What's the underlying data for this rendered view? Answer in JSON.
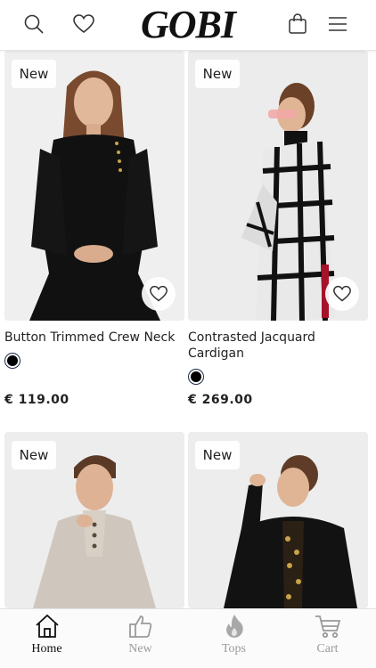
{
  "header": {
    "logo": "GOBI",
    "icons": [
      "search-icon",
      "heart-icon",
      "bag-icon",
      "menu-icon"
    ]
  },
  "products": [
    {
      "badge": "New",
      "name": "Button Trimmed Crew Neck",
      "price": "€ 119.00",
      "swatch_color": "#000000"
    },
    {
      "badge": "New",
      "name": "Contrasted Jacquard Cardigan",
      "price": "€ 269.00",
      "swatch_color": "#000000"
    },
    {
      "badge": "New",
      "name": "",
      "price": ""
    },
    {
      "badge": "New",
      "name": "",
      "price": ""
    }
  ],
  "bottom_nav": {
    "items": [
      {
        "label": "Home",
        "icon": "home-icon",
        "active": true
      },
      {
        "label": "New",
        "icon": "thumbs-up-icon",
        "active": false
      },
      {
        "label": "Tops",
        "icon": "flame-icon",
        "active": false
      },
      {
        "label": "Cart",
        "icon": "cart-icon",
        "active": false
      }
    ]
  },
  "colors": {
    "background": "#ffffff",
    "text": "#222222",
    "inactive_nav": "#9a9a9a"
  }
}
